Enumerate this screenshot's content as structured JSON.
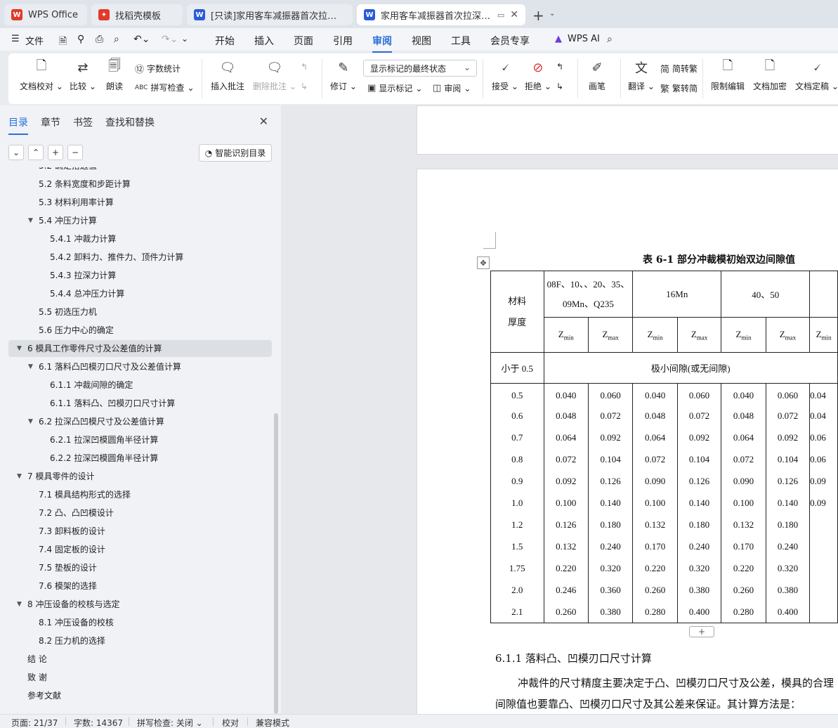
{
  "tabs": [
    {
      "label": "WPS Office",
      "icon": "wps-logo-icon",
      "color": "#e03b2a"
    },
    {
      "label": "找稻壳模板",
      "icon": "docer-icon",
      "color": "#e03b2a"
    },
    {
      "label": "[只读]家用客车减振器首次拉深模设计",
      "icon": "word-doc-icon",
      "color": "#2a5bd7"
    },
    {
      "label": "家用客车减振器首次拉深模设计",
      "icon": "word-doc-icon",
      "color": "#2a5bd7"
    }
  ],
  "menu": {
    "file": "文件",
    "items": [
      "开始",
      "插入",
      "页面",
      "引用",
      "审阅",
      "视图",
      "工具",
      "会员专享"
    ],
    "active": "审阅",
    "ai": "WPS AI"
  },
  "ribbon": {
    "doc_proof": "文档校对",
    "compare": "比较",
    "read_aloud": "朗读",
    "word_count": "字数统计",
    "spell_check": "拼写检查",
    "insert_comment": "插入批注",
    "delete_comment": "删除批注",
    "track": "修订",
    "markup_state": "显示标记的最终状态",
    "show_markup": "显示标记",
    "review": "审阅",
    "accept": "接受",
    "reject": "拒绝",
    "pen": "画笔",
    "translate": "翻译",
    "to_traditional": "简转繁",
    "to_simplified": "繁转简",
    "restrict_edit": "限制编辑",
    "doc_encrypt": "文档加密",
    "doc_finalize": "文档定稿"
  },
  "sidebar": {
    "tabs": [
      "目录",
      "章节",
      "书签",
      "查找和替换"
    ],
    "smart_toc": "智能识别目录",
    "items": [
      {
        "text": "5.2  确定搭边值",
        "level": 2,
        "arrow": false
      },
      {
        "text": "5.2  条料宽度和步距计算",
        "level": 2,
        "arrow": false
      },
      {
        "text": "5.3  材料利用率计算",
        "level": 2,
        "arrow": false
      },
      {
        "text": "5.4  冲压力计算",
        "level": 2,
        "arrow": true
      },
      {
        "text": "5.4.1 冲裁力计算",
        "level": 3,
        "arrow": false
      },
      {
        "text": "5.4.2 卸料力、推件力、顶件力计算",
        "level": 3,
        "arrow": false
      },
      {
        "text": "5.4.3 拉深力计算",
        "level": 3,
        "arrow": false
      },
      {
        "text": "5.4.4 总冲压力计算",
        "level": 3,
        "arrow": false
      },
      {
        "text": "5.5  初选压力机",
        "level": 2,
        "arrow": false
      },
      {
        "text": "5.6 压力中心的确定",
        "level": 2,
        "arrow": false
      },
      {
        "text": "6  模具工作零件尺寸及公差值的计算",
        "level": 1,
        "arrow": true,
        "selected": true
      },
      {
        "text": "6.1 落料凸凹模刃口尺寸及公差值计算",
        "level": 2,
        "arrow": true
      },
      {
        "text": "6.1.1 冲裁间隙的确定",
        "level": 3,
        "arrow": false
      },
      {
        "text": "6.1.1 落料凸、凹模刃口尺寸计算",
        "level": 3,
        "arrow": false
      },
      {
        "text": "6.2 拉深凸凹模尺寸及公差值计算",
        "level": 2,
        "arrow": true
      },
      {
        "text": "6.2.1 拉深凹模圆角半径计算",
        "level": 3,
        "arrow": false
      },
      {
        "text": "6.2.2 拉深凹模圆角半径计算",
        "level": 3,
        "arrow": false
      },
      {
        "text": "7  模具零件的设计",
        "level": 1,
        "arrow": true
      },
      {
        "text": "7.1  模具结构形式的选择",
        "level": 2,
        "arrow": false
      },
      {
        "text": "7.2  凸、凸凹模设计",
        "level": 2,
        "arrow": false
      },
      {
        "text": "7.3  卸料板的设计",
        "level": 2,
        "arrow": false
      },
      {
        "text": "7.4  固定板的设计",
        "level": 2,
        "arrow": false
      },
      {
        "text": "7.5  垫板的设计",
        "level": 2,
        "arrow": false
      },
      {
        "text": "7.6  模架的选择",
        "level": 2,
        "arrow": false
      },
      {
        "text": "8  冲压设备的校核与选定",
        "level": 1,
        "arrow": true
      },
      {
        "text": "8.1  冲压设备的校核",
        "level": 2,
        "arrow": false
      },
      {
        "text": "8.2 压力机的选择",
        "level": 2,
        "arrow": false
      },
      {
        "text": "结    论",
        "level": 1,
        "arrow": false
      },
      {
        "text": "致    谢",
        "level": 1,
        "arrow": false
      },
      {
        "text": "参考文献",
        "level": 1,
        "arrow": false
      }
    ]
  },
  "document": {
    "table_caption": "表 6-1  部分冲裁模初始双边间隙值",
    "col_material": "材料\n厚度",
    "groups": [
      "08F、10、、20、35、09Mn、Q235",
      "16Mn",
      "40、50",
      ""
    ],
    "zmin": "Z",
    "zmin_sub": "min",
    "zmax": "Z",
    "zmax_sub": "max",
    "row_small": {
      "thickness": "小于 0.5",
      "note": "极小间隙(或无间隙)"
    },
    "rows": [
      [
        "0.5",
        "0.040",
        "0.060",
        "0.040",
        "0.060",
        "0.040",
        "0.060",
        "0.04"
      ],
      [
        "0.6",
        "0.048",
        "0.072",
        "0.048",
        "0.072",
        "0.048",
        "0.072",
        "0.04"
      ],
      [
        "0.7",
        "0.064",
        "0.092",
        "0.064",
        "0.092",
        "0.064",
        "0.092",
        "0.06"
      ],
      [
        "0.8",
        "0.072",
        "0.104",
        "0.072",
        "0.104",
        "0.072",
        "0.104",
        "0.06"
      ],
      [
        "0.9",
        "0.092",
        "0.126",
        "0.090",
        "0.126",
        "0.090",
        "0.126",
        "0.09"
      ],
      [
        "1.0",
        "0.100",
        "0.140",
        "0.100",
        "0.140",
        "0.100",
        "0.140",
        "0.09"
      ],
      [
        "1.2",
        "0.126",
        "0.180",
        "0.132",
        "0.180",
        "0.132",
        "0.180",
        ""
      ],
      [
        "1.5",
        "0.132",
        "0.240",
        "0.170",
        "0.240",
        "0.170",
        "0.240",
        ""
      ],
      [
        "1.75",
        "0.220",
        "0.320",
        "0.220",
        "0.320",
        "0.220",
        "0.320",
        ""
      ],
      [
        "2.0",
        "0.246",
        "0.360",
        "0.260",
        "0.380",
        "0.260",
        "0.380",
        ""
      ],
      [
        "2.1",
        "0.260",
        "0.380",
        "0.280",
        "0.400",
        "0.280",
        "0.400",
        ""
      ]
    ],
    "heading": "6.1.1 落料凸、凹模刃口尺寸计算",
    "paragraph": "冲裁件的尺寸精度主要决定于凸、凹模刃口尺寸及公差，模具的合理间隙值也要靠凸、凹模刃口尺寸及其公差来保证。其计算方法是："
  },
  "status": {
    "page": "页面: 21/37",
    "words": "字数: 14367",
    "spell": "拼写检查: 关闭",
    "proof": "校对",
    "compat": "兼容模式"
  }
}
